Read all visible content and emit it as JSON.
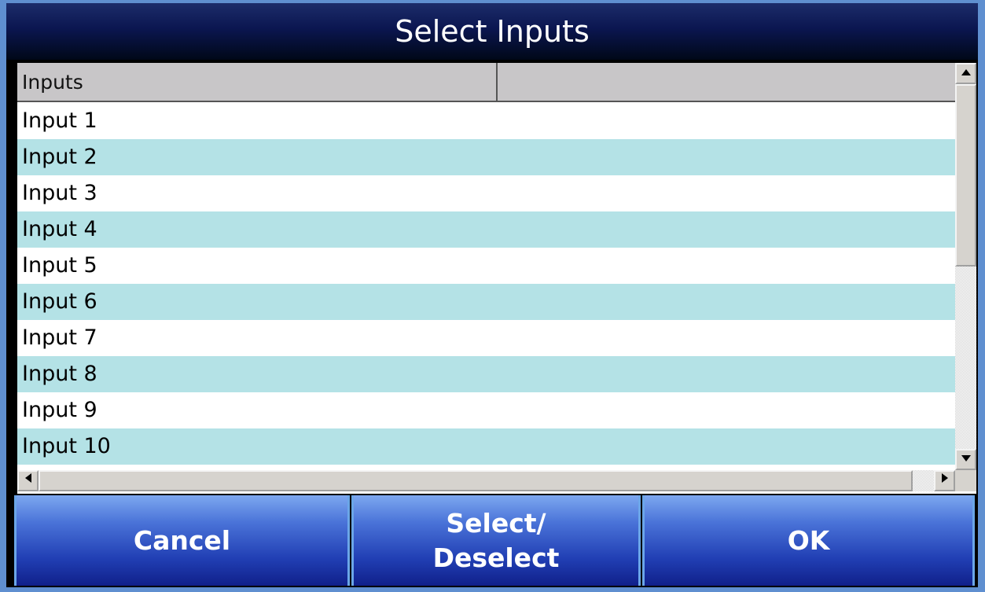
{
  "dialog": {
    "title": "Select Inputs"
  },
  "list": {
    "columns": [
      "Inputs",
      ""
    ],
    "rows": [
      "Input 1",
      "Input 2",
      "Input 3",
      "Input 4",
      "Input 5",
      "Input 6",
      "Input 7",
      "Input 8",
      "Input 9",
      "Input 10"
    ]
  },
  "buttons": {
    "cancel": "Cancel",
    "select_line1": "Select/",
    "select_line2": "Deselect",
    "ok": "OK"
  },
  "colors": {
    "title_bg": "#0b1650",
    "alt_row": "#b4e2e6",
    "button_blue": "#213fb4",
    "header_bg": "#c8c6c8"
  },
  "icons": {
    "scroll_up": "triangle-up-icon",
    "scroll_down": "triangle-down-icon",
    "scroll_left": "triangle-left-icon",
    "scroll_right": "triangle-right-icon"
  }
}
